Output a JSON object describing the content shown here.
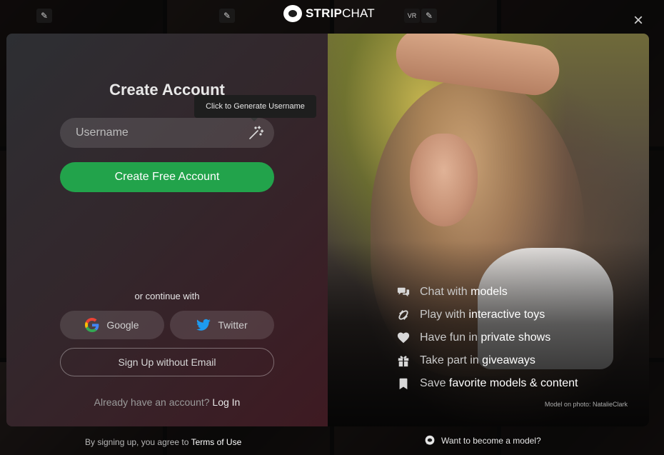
{
  "brand": {
    "name_bold": "STRIP",
    "name_thin": "CHAT"
  },
  "close": {
    "icon": "close-icon",
    "label": "×"
  },
  "tile_labels": {
    "vr": "VR"
  },
  "signup": {
    "title": "Create Account",
    "tooltip": "Click to Generate Username",
    "username_placeholder": "Username",
    "username_value": "",
    "create_button": "Create Free Account",
    "continue_text": "or continue with",
    "google_label": "Google",
    "twitter_label": "Twitter",
    "no_email_button": "Sign Up without Email",
    "login_prompt": "Already have an account?",
    "login_link": "Log In"
  },
  "features": [
    {
      "icon": "chat-bubbles-icon",
      "prefix": "Chat with ",
      "highlight": "models",
      "suffix": ""
    },
    {
      "icon": "toy-icon",
      "prefix": "Play with ",
      "highlight": "interactive toys",
      "suffix": ""
    },
    {
      "icon": "heart-icon",
      "prefix": "Have fun in ",
      "highlight": "private shows",
      "suffix": ""
    },
    {
      "icon": "gift-icon",
      "prefix": "Take part in ",
      "highlight": "giveaways",
      "suffix": ""
    },
    {
      "icon": "bookmark-icon",
      "prefix": "Save ",
      "highlight": "favorite models & content",
      "suffix": ""
    }
  ],
  "model_credit": "Model on photo: NatalieClark",
  "footer": {
    "terms_prefix": "By signing up, you agree to",
    "terms_link": "Terms of Use",
    "become_model": "Want to become a model?"
  },
  "colors": {
    "accent_green": "#22a34b",
    "twitter_blue": "#1d9bf0"
  }
}
